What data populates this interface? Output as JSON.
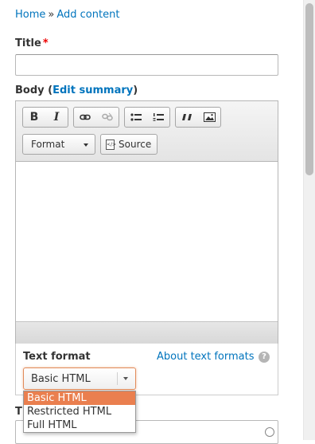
{
  "breadcrumb": {
    "home": "Home",
    "separator": "»",
    "current": "Add content"
  },
  "title_field": {
    "label": "Title",
    "required_marker": "*",
    "value": ""
  },
  "body_field": {
    "label": "Body",
    "open_paren": "(",
    "edit_summary": "Edit summary",
    "close_paren": ")"
  },
  "editor": {
    "toolbar": {
      "bold": "B",
      "italic": "I",
      "format_combo": "Format",
      "source": "Source"
    },
    "icons": [
      "bold-icon",
      "italic-icon",
      "link-icon",
      "unlink-icon",
      "bulleted-list-icon",
      "numbered-list-icon",
      "blockquote-icon",
      "image-icon",
      "source-icon"
    ]
  },
  "text_format": {
    "label": "Text format",
    "about_link": "About text formats",
    "help": "?",
    "selected": "Basic HTML",
    "options": [
      "Basic HTML",
      "Restricted HTML",
      "Full HTML"
    ]
  },
  "next_field": {
    "label_fragment": "T"
  },
  "colors": {
    "link": "#0074bd",
    "required": "#ee0000",
    "dropdown_highlight": "#ea7f4f"
  }
}
